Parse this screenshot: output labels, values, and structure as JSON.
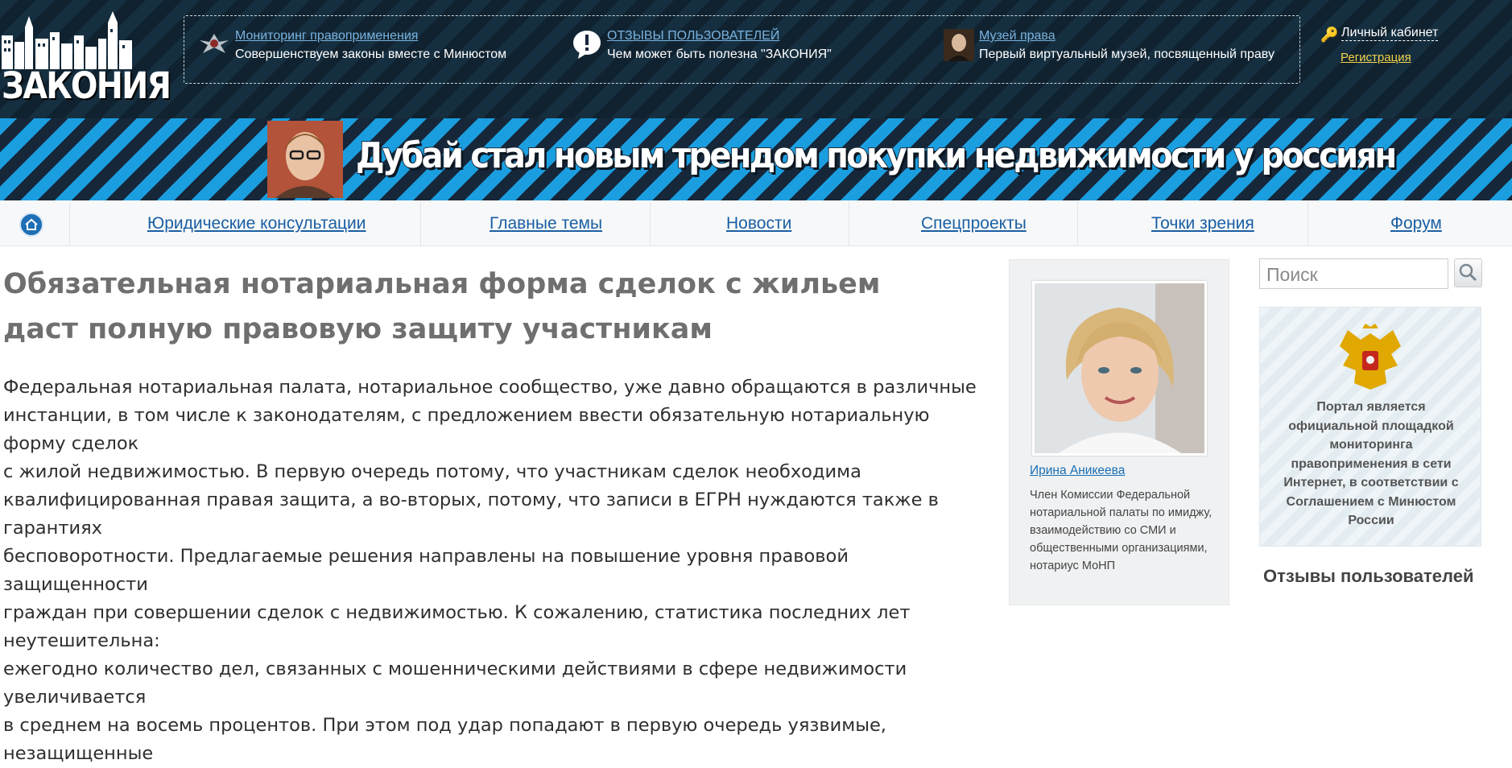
{
  "header": {
    "logo_text": "ЗАКОНИЯ",
    "info_items": [
      {
        "link": "Мониторинг правоприменения",
        "subtitle": "Совершенствуем законы вместе с Минюстом",
        "icon": "ministry-emblem-icon"
      },
      {
        "link": "ОТЗЫВЫ ПОЛЬЗОВАТЕЛЕЙ",
        "subtitle": "Чем может быть полезна \"ЗАКОНИЯ\"",
        "icon": "exclamation-bubble-icon"
      },
      {
        "link": "Музей права",
        "subtitle": "Первый виртуальный музей, посвященный праву",
        "icon": "museum-portrait-icon"
      }
    ],
    "account": {
      "cabinet": "Личный кабинет",
      "register": "Регистрация",
      "icon": "key-icon"
    }
  },
  "banner": {
    "headline": "Дубай стал новым трендом покупки недвижимости у россиян"
  },
  "nav": {
    "home_icon": "home-icon",
    "items": [
      "Юридические консультации",
      "Главные темы",
      "Новости",
      "Спецпроекты",
      "Точки зрения",
      "Форум"
    ]
  },
  "article": {
    "title": "Обязательная нотариальная форма сделок с жильем даст полную правовую защиту участникам",
    "lines": [
      "Федеральная нотариальная палата, нотариальное сообщество, уже давно обращаются в различные",
      "инстанции, в том числе к законодателям, с предложением ввести обязательную нотариальную форму сделок",
      "с жилой недвижимостью. В первую очередь потому, что участникам сделок необходима",
      "квалифицированная правая защита, а во-вторых, потому, что записи в ЕГРН нуждаются также в гарантиях",
      "бесповоротности. Предлагаемые решения направлены на повышение уровня правовой защищенности",
      "граждан при совершении сделок с недвижимостью. К сожалению, статистика последних лет неутешительна:",
      "ежегодно количество дел, связанных с мошенническими действиями в сфере недвижимости увеличивается",
      "в среднем на восемь процентов. При этом под удар попадают в первую очередь уязвимые, незащищенные"
    ]
  },
  "author": {
    "name": "Ирина Аникеева",
    "role": "Член Комиссии Федеральной нотариальной палаты по имиджу, взаимодействию со СМИ и общественными организациями, нотариус МоНП"
  },
  "sidebar": {
    "search_placeholder": "Поиск",
    "search_icon": "search-icon",
    "portal_text": "Портал является официальной площадкой мониторинга правоприменения в сети Интернет, в соответствии с Соглашением с Минюстом России",
    "emblem_icon": "russian-coat-of-arms-icon",
    "reviews_title": "Отзывы пользователей"
  },
  "colors": {
    "link": "#1a5fa3",
    "banner_stripe": "#1b9ee0",
    "header_bg": "#162f40"
  }
}
